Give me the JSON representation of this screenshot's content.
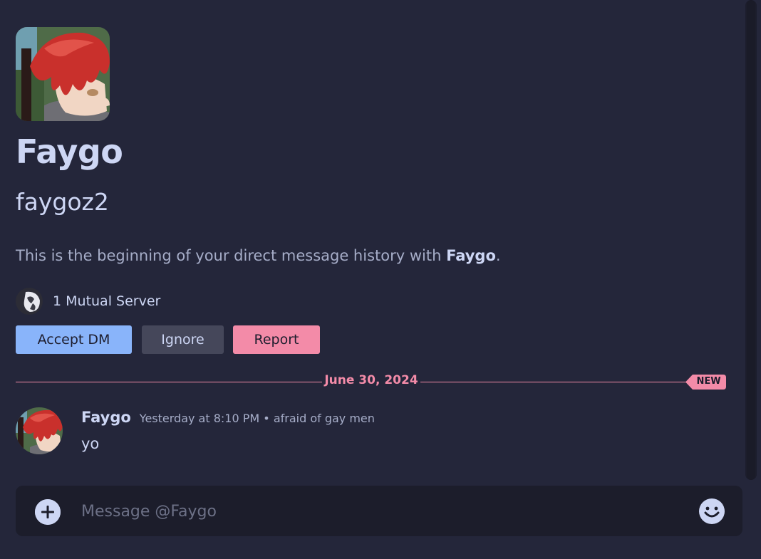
{
  "profile": {
    "display_name": "Faygo",
    "username": "faygoz2",
    "intro_prefix": "This is the beginning of your direct message history with ",
    "intro_name": "Faygo",
    "intro_suffix": ".",
    "mutual_servers": "1 Mutual Server",
    "avatar_icon": "anime-redhead-avatar"
  },
  "actions": {
    "accept_label": "Accept DM",
    "ignore_label": "Ignore",
    "report_label": "Report"
  },
  "divider": {
    "date": "June 30, 2024",
    "badge": "NEW"
  },
  "message": {
    "author": "Faygo",
    "timestamp": "Yesterday at 8:10 PM",
    "separator": "•",
    "custom_status": "afraid of gay men",
    "text": "yo"
  },
  "composer": {
    "placeholder": "Message @Faygo",
    "value": ""
  },
  "colors": {
    "background": "#24263a",
    "accent_blue": "#89b4fa",
    "accent_red": "#f38ba8",
    "button_gray": "#45475a",
    "composer_bg": "#1c1d2b"
  }
}
